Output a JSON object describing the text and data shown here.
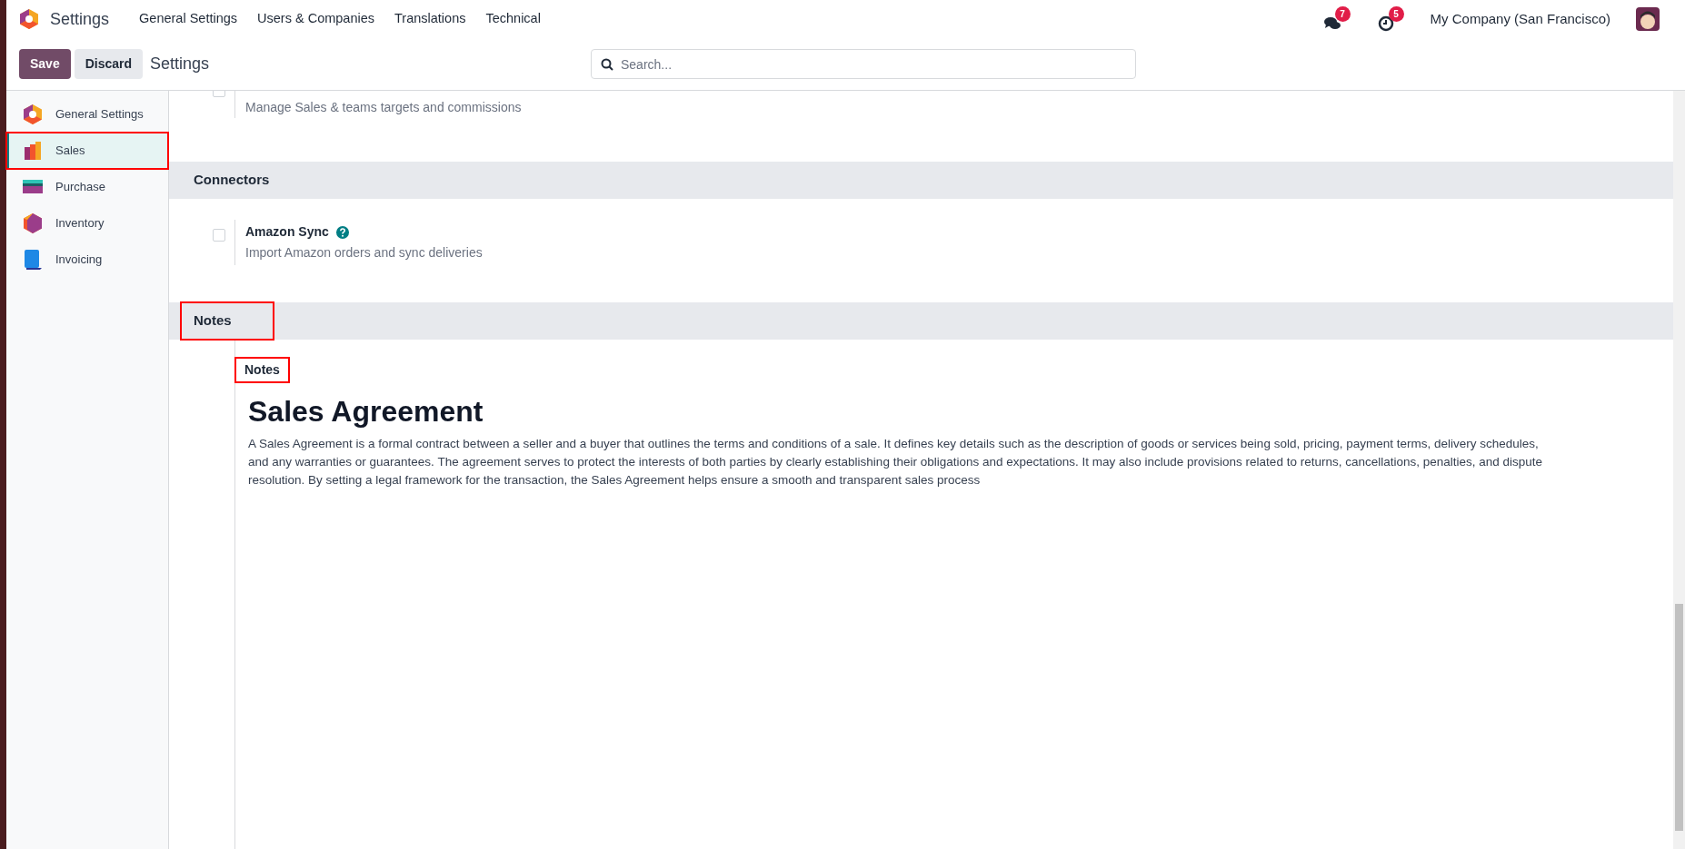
{
  "app": {
    "title": "Settings"
  },
  "menu": [
    {
      "label": "General Settings"
    },
    {
      "label": "Users & Companies"
    },
    {
      "label": "Translations"
    },
    {
      "label": "Technical"
    }
  ],
  "systray": {
    "messages_count": "7",
    "activities_count": "5",
    "company": "My Company (San Francisco)"
  },
  "control_panel": {
    "save": "Save",
    "discard": "Discard",
    "breadcrumb": "Settings",
    "search": {
      "placeholder": "Search..."
    }
  },
  "sidebar": {
    "items": [
      {
        "label": "General Settings",
        "kind": "general",
        "selected": false,
        "highlighted": false
      },
      {
        "label": "Sales",
        "kind": "sales",
        "selected": true,
        "highlighted": true
      },
      {
        "label": "Purchase",
        "kind": "purchase",
        "selected": false,
        "highlighted": false
      },
      {
        "label": "Inventory",
        "kind": "inventory",
        "selected": false,
        "highlighted": false
      },
      {
        "label": "Invoicing",
        "kind": "invoicing",
        "selected": false,
        "highlighted": false
      }
    ]
  },
  "top_setting": {
    "description": "Manage Sales & teams targets and commissions",
    "checked": false
  },
  "sections": [
    {
      "title": "Connectors",
      "highlighted": false,
      "settings": [
        {
          "title": "Amazon Sync",
          "description": "Import Amazon orders and sync deliveries",
          "checked": false,
          "help": true
        }
      ]
    },
    {
      "title": "Notes",
      "highlighted": true,
      "field": {
        "label": "Notes",
        "highlighted": true,
        "heading": "Sales Agreement",
        "body": "A Sales Agreement is a formal contract between a seller and a buyer that outlines the terms and conditions of a sale. It defines key details such as the description of goods or services being sold, pricing, payment terms, delivery schedules, and any warranties or guarantees. The agreement serves to protect the interests of both parties by clearly establishing their obligations and expectations. It may also include provisions related to returns, cancellations, penalties, and dispute resolution. By setting a legal framework for the transaction, the Sales Agreement helps ensure a smooth and transparent sales process"
      }
    }
  ]
}
